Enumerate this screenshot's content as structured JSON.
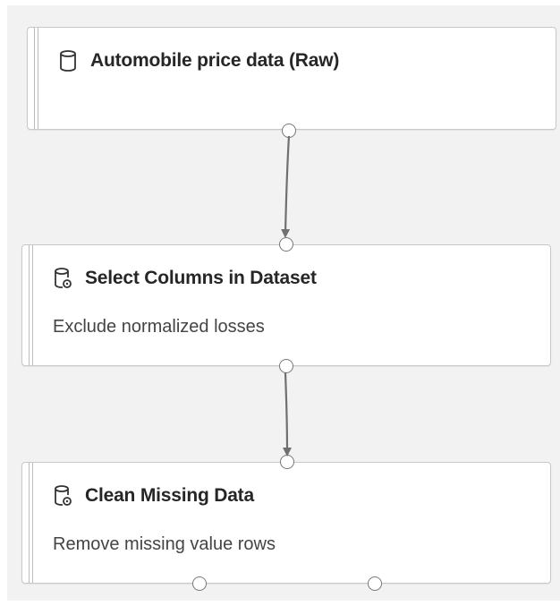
{
  "modules": [
    {
      "title": "Automobile price data (Raw)",
      "subtitle": "",
      "icon": "dataset-icon"
    },
    {
      "title": "Select Columns in Dataset",
      "subtitle": "Exclude normalized losses",
      "icon": "dataset-settings-icon"
    },
    {
      "title": "Clean Missing Data",
      "subtitle": "Remove missing value rows",
      "icon": "dataset-settings-icon"
    }
  ],
  "colors": {
    "canvas": "#f2f2f2",
    "connector": "#707070",
    "border": "#c8c8c8"
  }
}
